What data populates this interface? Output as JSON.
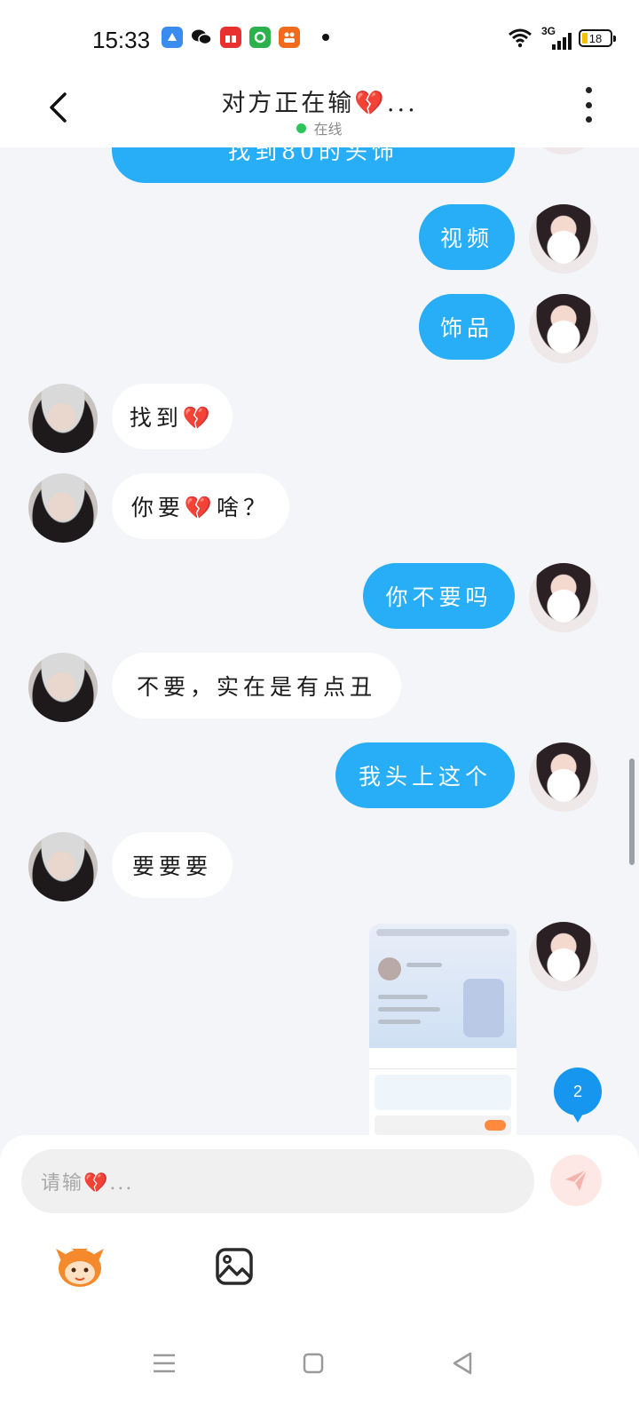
{
  "status_bar": {
    "time": "15:33",
    "network": "3G",
    "battery": "18",
    "apps": [
      "browser-icon",
      "wechat-icon",
      "gift-app-icon",
      "green-app-icon",
      "group-app-icon"
    ]
  },
  "header": {
    "title": "对方正在输💔...",
    "status": "在线"
  },
  "messages": [
    {
      "from": "me",
      "text": "找到80的头饰"
    },
    {
      "from": "me",
      "text": "视频"
    },
    {
      "from": "me",
      "text": "饰品"
    },
    {
      "from": "them",
      "text": "找到💔"
    },
    {
      "from": "them",
      "text": "你要💔啥？"
    },
    {
      "from": "me",
      "text": "你不要吗"
    },
    {
      "from": "them",
      "text": "不要，实在是有点丑"
    },
    {
      "from": "me",
      "text": "我头上这个"
    },
    {
      "from": "them",
      "text": "要要要"
    },
    {
      "from": "me",
      "type": "image",
      "text": ""
    }
  ],
  "unread_count": "2",
  "composer": {
    "placeholder": "请输💔...",
    "tools": [
      "sticker-icon",
      "image-icon"
    ]
  },
  "colors": {
    "my_bubble": "#27aef7",
    "their_bubble": "#ffffff",
    "background": "#f3f5f8",
    "online": "#2bc55a"
  }
}
